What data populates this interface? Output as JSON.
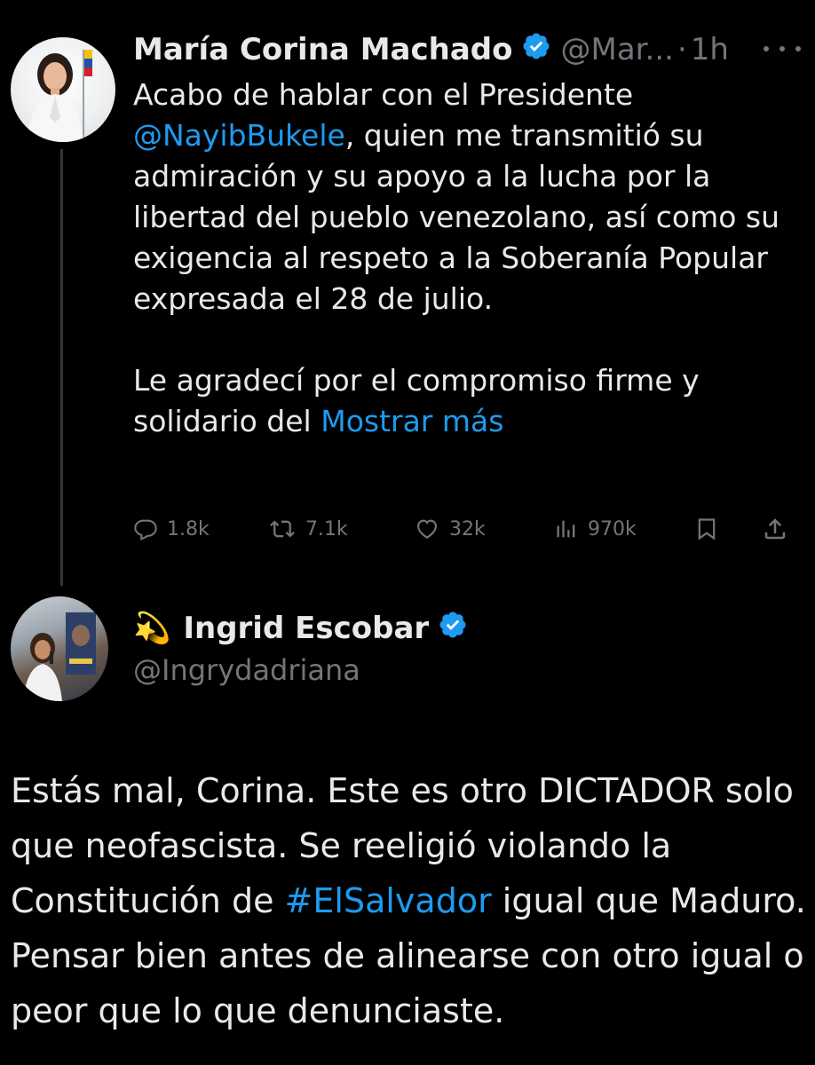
{
  "tweet1": {
    "author_name": "María Corina Machado",
    "handle": "@Mar...",
    "separator": "·",
    "time": "1h",
    "body": {
      "p1_before": "Acabo de hablar con el Presidente ",
      "p1_mention": "@NayibBukele",
      "p1_after": ", quien me transmitió su admiración y su apoyo a la lucha por la libertad del pueblo venezolano, así como su exigencia al respeto a la Soberanía Popular expresada el 28 de julio.",
      "p2_before": "Le agradecí por el compromiso firme y solidario del ",
      "p2_more": "Mostrar más"
    },
    "stats": {
      "replies": "1.8k",
      "retweets": "7.1k",
      "likes": "32k",
      "views": "970k"
    }
  },
  "tweet2": {
    "emoji": "💫",
    "author_name": "Ingrid Escobar",
    "handle": "@Ingrydadriana",
    "body": {
      "before": "Estás mal, Corina. Este es otro DICTADOR solo que neofascista. Se reeligió violando la Constitución de ",
      "hashtag": "#ElSalvador",
      "after": " igual que Maduro. Pensar bien antes de alinearse con otro igual o peor que lo que denunciaste."
    }
  },
  "colors": {
    "background": "#000000",
    "text": "#e7e9ea",
    "muted": "#71767b",
    "link": "#1d9bf0",
    "verified": "#1d9bf0"
  },
  "icons": [
    "verified-badge-icon",
    "more-icon",
    "reply-icon",
    "retweet-icon",
    "like-icon",
    "views-icon",
    "bookmark-icon",
    "share-icon"
  ]
}
